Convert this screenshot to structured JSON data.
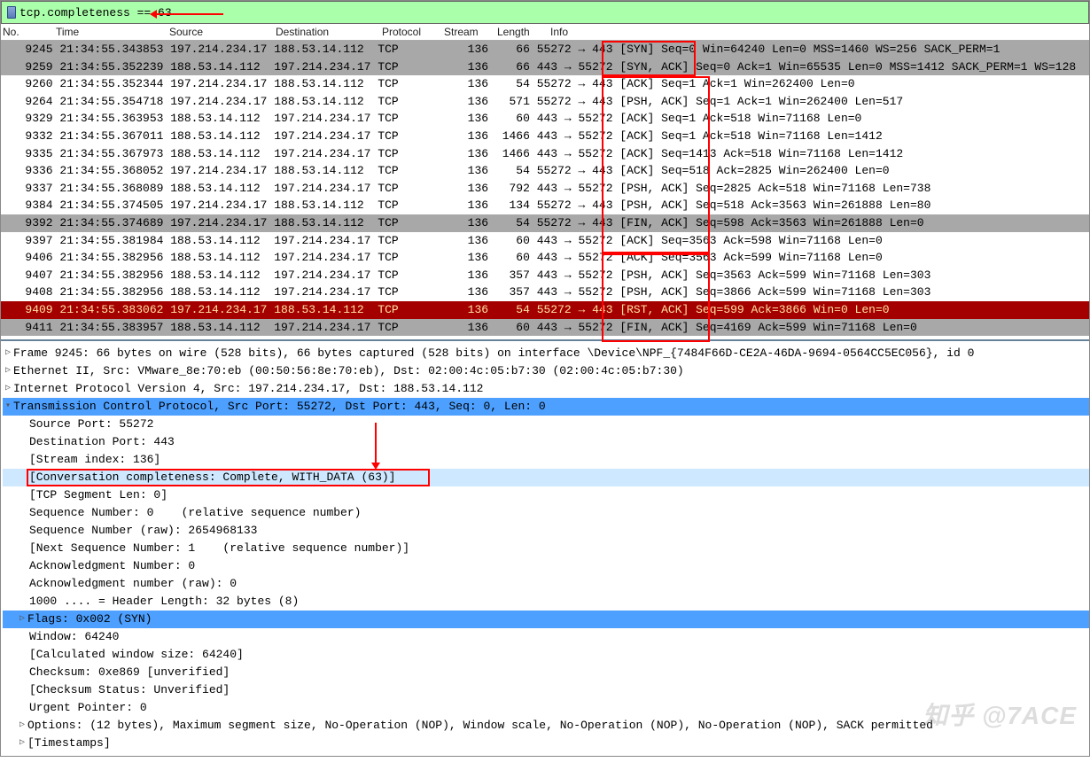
{
  "filter": {
    "text": "tcp.completeness == 63"
  },
  "columns": {
    "no": "No.",
    "time": "Time",
    "src": "Source",
    "dst": "Destination",
    "proto": "Protocol",
    "stream": "Stream",
    "len": "Length",
    "info": "Info"
  },
  "packets": [
    {
      "n": "9245",
      "t": "21:34:55.343853",
      "s": "197.214.234.17",
      "d": "188.53.14.112",
      "p": "TCP",
      "st": "136",
      "l": "66",
      "i": "55272 → 443 [SYN] Seq=0 Win=64240 Len=0 MSS=1460 WS=256 SACK_PERM=1",
      "cls": "sel"
    },
    {
      "n": "9259",
      "t": "21:34:55.352239",
      "s": "188.53.14.112",
      "d": "197.214.234.17",
      "p": "TCP",
      "st": "136",
      "l": "66",
      "i": "443 → 55272 [SYN, ACK] Seq=0 Ack=1 Win=65535 Len=0 MSS=1412 SACK_PERM=1 WS=128",
      "cls": "sel"
    },
    {
      "n": "9260",
      "t": "21:34:55.352344",
      "s": "197.214.234.17",
      "d": "188.53.14.112",
      "p": "TCP",
      "st": "136",
      "l": "54",
      "i": "55272 → 443 [ACK] Seq=1 Ack=1 Win=262400 Len=0",
      "cls": ""
    },
    {
      "n": "9264",
      "t": "21:34:55.354718",
      "s": "197.214.234.17",
      "d": "188.53.14.112",
      "p": "TCP",
      "st": "136",
      "l": "571",
      "i": "55272 → 443 [PSH, ACK] Seq=1 Ack=1 Win=262400 Len=517",
      "cls": ""
    },
    {
      "n": "9329",
      "t": "21:34:55.363953",
      "s": "188.53.14.112",
      "d": "197.214.234.17",
      "p": "TCP",
      "st": "136",
      "l": "60",
      "i": "443 → 55272 [ACK] Seq=1 Ack=518 Win=71168 Len=0",
      "cls": ""
    },
    {
      "n": "9332",
      "t": "21:34:55.367011",
      "s": "188.53.14.112",
      "d": "197.214.234.17",
      "p": "TCP",
      "st": "136",
      "l": "1466",
      "i": "443 → 55272 [ACK] Seq=1 Ack=518 Win=71168 Len=1412",
      "cls": ""
    },
    {
      "n": "9335",
      "t": "21:34:55.367973",
      "s": "188.53.14.112",
      "d": "197.214.234.17",
      "p": "TCP",
      "st": "136",
      "l": "1466",
      "i": "443 → 55272 [ACK] Seq=1413 Ack=518 Win=71168 Len=1412",
      "cls": ""
    },
    {
      "n": "9336",
      "t": "21:34:55.368052",
      "s": "197.214.234.17",
      "d": "188.53.14.112",
      "p": "TCP",
      "st": "136",
      "l": "54",
      "i": "55272 → 443 [ACK] Seq=518 Ack=2825 Win=262400 Len=0",
      "cls": ""
    },
    {
      "n": "9337",
      "t": "21:34:55.368089",
      "s": "188.53.14.112",
      "d": "197.214.234.17",
      "p": "TCP",
      "st": "136",
      "l": "792",
      "i": "443 → 55272 [PSH, ACK] Seq=2825 Ack=518 Win=71168 Len=738",
      "cls": ""
    },
    {
      "n": "9384",
      "t": "21:34:55.374505",
      "s": "197.214.234.17",
      "d": "188.53.14.112",
      "p": "TCP",
      "st": "136",
      "l": "134",
      "i": "55272 → 443 [PSH, ACK] Seq=518 Ack=3563 Win=261888 Len=80",
      "cls": ""
    },
    {
      "n": "9392",
      "t": "21:34:55.374689",
      "s": "197.214.234.17",
      "d": "188.53.14.112",
      "p": "TCP",
      "st": "136",
      "l": "54",
      "i": "55272 → 443 [FIN, ACK] Seq=598 Ack=3563 Win=261888 Len=0",
      "cls": "sel"
    },
    {
      "n": "9397",
      "t": "21:34:55.381984",
      "s": "188.53.14.112",
      "d": "197.214.234.17",
      "p": "TCP",
      "st": "136",
      "l": "60",
      "i": "443 → 55272 [ACK] Seq=3563 Ack=598 Win=71168 Len=0",
      "cls": ""
    },
    {
      "n": "9406",
      "t": "21:34:55.382956",
      "s": "188.53.14.112",
      "d": "197.214.234.17",
      "p": "TCP",
      "st": "136",
      "l": "60",
      "i": "443 → 55272 [ACK] Seq=3563 Ack=599 Win=71168 Len=0",
      "cls": ""
    },
    {
      "n": "9407",
      "t": "21:34:55.382956",
      "s": "188.53.14.112",
      "d": "197.214.234.17",
      "p": "TCP",
      "st": "136",
      "l": "357",
      "i": "443 → 55272 [PSH, ACK] Seq=3563 Ack=599 Win=71168 Len=303",
      "cls": ""
    },
    {
      "n": "9408",
      "t": "21:34:55.382956",
      "s": "188.53.14.112",
      "d": "197.214.234.17",
      "p": "TCP",
      "st": "136",
      "l": "357",
      "i": "443 → 55272 [PSH, ACK] Seq=3866 Ack=599 Win=71168 Len=303",
      "cls": ""
    },
    {
      "n": "9409",
      "t": "21:34:55.383062",
      "s": "197.214.234.17",
      "d": "188.53.14.112",
      "p": "TCP",
      "st": "136",
      "l": "54",
      "i": "55272 → 443 [RST, ACK] Seq=599 Ack=3866 Win=0 Len=0",
      "cls": "rst"
    },
    {
      "n": "9411",
      "t": "21:34:55.383957",
      "s": "188.53.14.112",
      "d": "197.214.234.17",
      "p": "TCP",
      "st": "136",
      "l": "60",
      "i": "443 → 55272 [FIN, ACK] Seq=4169 Ack=599 Win=71168 Len=0",
      "cls": "sel"
    }
  ],
  "details": {
    "frame": "Frame 9245: 66 bytes on wire (528 bits), 66 bytes captured (528 bits) on interface \\Device\\NPF_{7484F66D-CE2A-46DA-9694-0564CC5EC056}, id 0",
    "eth": "Ethernet II, Src: VMware_8e:70:eb (00:50:56:8e:70:eb), Dst: 02:00:4c:05:b7:30 (02:00:4c:05:b7:30)",
    "ip": "Internet Protocol Version 4, Src: 197.214.234.17, Dst: 188.53.14.112",
    "tcp": "Transmission Control Protocol, Src Port: 55272, Dst Port: 443, Seq: 0, Len: 0",
    "fields": [
      "Source Port: 55272",
      "Destination Port: 443",
      "[Stream index: 136]",
      "[Conversation completeness: Complete, WITH_DATA (63)]",
      "[TCP Segment Len: 0]",
      "Sequence Number: 0    (relative sequence number)",
      "Sequence Number (raw): 2654968133",
      "[Next Sequence Number: 1    (relative sequence number)]",
      "Acknowledgment Number: 0",
      "Acknowledgment number (raw): 0",
      "1000 .... = Header Length: 32 bytes (8)"
    ],
    "flags": "Flags: 0x002 (SYN)",
    "after": [
      "Window: 64240",
      "[Calculated window size: 64240]",
      "Checksum: 0xe869 [unverified]",
      "[Checksum Status: Unverified]",
      "Urgent Pointer: 0"
    ],
    "options": "Options: (12 bytes), Maximum segment size, No-Operation (NOP), Window scale, No-Operation (NOP), No-Operation (NOP), SACK permitted",
    "timestamps": "[Timestamps]"
  },
  "watermark": "知乎 @7ACE"
}
